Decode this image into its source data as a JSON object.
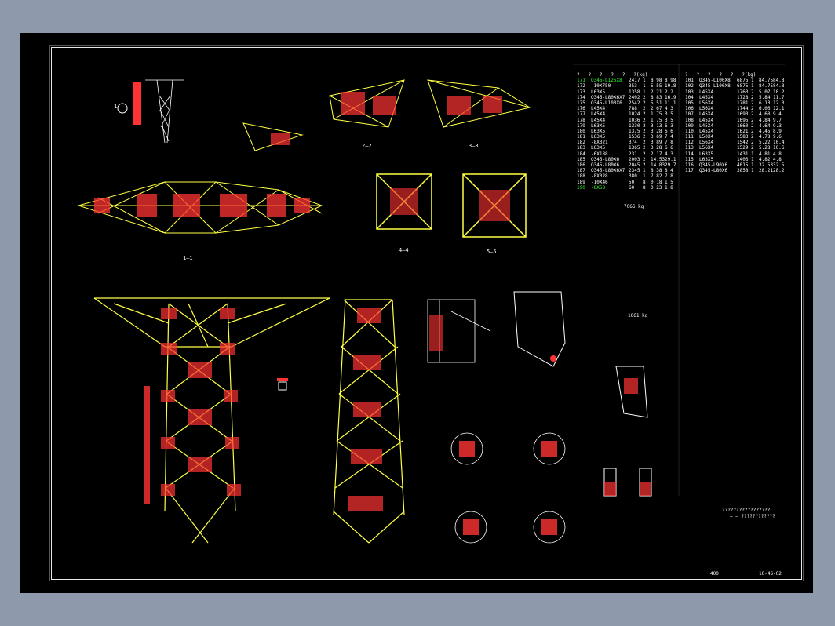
{
  "drawing": {
    "index_mark": "1",
    "section_labels": [
      "2—2",
      "3—3",
      "1—1",
      "4—4",
      "5—5"
    ],
    "total_weight_label": "7066 kg",
    "grand_total_label": "1061 kg",
    "title_block": {
      "code": "10-4S-02",
      "red_text": "400"
    }
  },
  "parts_table_left": {
    "header": [
      "?",
      "?",
      "?",
      "?",
      "?",
      "?(kg)"
    ],
    "rows": [
      {
        "no": "171",
        "spec": "Q345-L125X8",
        "len": "2417",
        "qty": "1",
        "w1": "8.98",
        "w2": "8.98",
        "hl": true
      },
      {
        "no": "172",
        "spec": "-10X750",
        "len": "353",
        "qty": "1",
        "w1": "5.55",
        "w2": "19.8",
        "hl": false
      },
      {
        "no": "173",
        "spec": "L63X5",
        "len": "1358",
        "qty": "1",
        "w1": "2.21",
        "w2": "2.2",
        "hl": false
      },
      {
        "no": "174",
        "spec": "Q345-L80X6X7",
        "len": "2402",
        "qty": "2",
        "w1": "8.83",
        "w2": "16.9",
        "hl": false
      },
      {
        "no": "175",
        "spec": "Q345-L100X6",
        "len": "2542",
        "qty": "2",
        "w1": "5.51",
        "w2": "11.1",
        "hl": false
      },
      {
        "no": "176",
        "spec": "L45X4",
        "len": "788",
        "qty": "2",
        "w1": "2.67",
        "w2": "4.3",
        "hl": false
      },
      {
        "no": "177",
        "spec": "L45X4",
        "len": "1024",
        "qty": "2",
        "w1": "1.75",
        "w2": "3.5",
        "hl": false
      },
      {
        "no": "178",
        "spec": "L45X4",
        "len": "1036",
        "qty": "2",
        "w1": "1.75",
        "w2": "3.5",
        "hl": false
      },
      {
        "no": "179",
        "spec": "L63X5",
        "len": "1330",
        "qty": "2",
        "w1": "3.13",
        "w2": "6.3",
        "hl": false
      },
      {
        "no": "180",
        "spec": "L63X5",
        "len": "1375",
        "qty": "2",
        "w1": "3.28",
        "w2": "6.6",
        "hl": false
      },
      {
        "no": "181",
        "spec": "L63X5",
        "len": "1536",
        "qty": "2",
        "w1": "3.69",
        "w2": "7.4",
        "hl": false
      },
      {
        "no": "182",
        "spec": "-8X321",
        "len": "374",
        "qty": "2",
        "w1": "3.89",
        "w2": "7.8",
        "hl": false
      },
      {
        "no": "183",
        "spec": "L63X5",
        "len": "1365",
        "qty": "2",
        "w1": "3.28",
        "w2": "6.6",
        "hl": false
      },
      {
        "no": "184",
        "spec": "-6X188",
        "len": "231",
        "qty": "2",
        "w1": "2.17",
        "w2": "4.3",
        "hl": false
      },
      {
        "no": "185",
        "spec": "Q345-L80X6",
        "len": "2003",
        "qty": "2",
        "w1": "14.53",
        "w2": "29.1",
        "hl": false
      },
      {
        "no": "186",
        "spec": "Q345-L80X6",
        "len": "2045",
        "qty": "2",
        "w1": "14.83",
        "w2": "29.7",
        "hl": false
      },
      {
        "no": "187",
        "spec": "Q345-L80X6X7",
        "len": "2345",
        "qty": "1",
        "w1": "8.38",
        "w2": "8.4",
        "hl": false
      },
      {
        "no": "188",
        "spec": "-8X328",
        "len": "380",
        "qty": "1",
        "w1": "7.82",
        "w2": "7.8",
        "hl": false
      },
      {
        "no": "189",
        "spec": "-10X46",
        "len": "50",
        "qty": "8",
        "w1": "0.18",
        "w2": "1.5",
        "hl": false
      },
      {
        "no": "190",
        "spec": "-8X58",
        "len": "60",
        "qty": "8",
        "w1": "0.23",
        "w2": "1.8",
        "hl": true
      }
    ]
  },
  "parts_table_right": {
    "header": [
      "?",
      "?",
      "?",
      "?",
      "?",
      "?(kg)"
    ],
    "rows": [
      {
        "no": "101",
        "spec": "Q345-L100X8",
        "len": "6875",
        "qty": "1",
        "w1": "84.75",
        "w2": "84.8"
      },
      {
        "no": "102",
        "spec": "Q345-L100X8",
        "len": "6875",
        "qty": "1",
        "w1": "84.75",
        "w2": "84.8"
      },
      {
        "no": "103",
        "spec": "L45X4",
        "len": "1763",
        "qty": "2",
        "w1": "5.07",
        "w2": "10.2"
      },
      {
        "no": "104",
        "spec": "L45X4",
        "len": "1728",
        "qty": "2",
        "w1": "5.84",
        "w2": "11.7"
      },
      {
        "no": "105",
        "spec": "L56X4",
        "len": "1781",
        "qty": "2",
        "w1": "6.13",
        "w2": "12.3"
      },
      {
        "no": "106",
        "spec": "L56X4",
        "len": "1744",
        "qty": "2",
        "w1": "6.06",
        "w2": "12.1"
      },
      {
        "no": "107",
        "spec": "L45X4",
        "len": "1693",
        "qty": "2",
        "w1": "4.68",
        "w2": "9.4"
      },
      {
        "no": "108",
        "spec": "L45X4",
        "len": "1695",
        "qty": "2",
        "w1": "4.84",
        "w2": "9.7"
      },
      {
        "no": "109",
        "spec": "L45X4",
        "len": "1660",
        "qty": "2",
        "w1": "4.64",
        "w2": "9.3"
      },
      {
        "no": "110",
        "spec": "L45X4",
        "len": "1621",
        "qty": "2",
        "w1": "4.45",
        "w2": "8.9"
      },
      {
        "no": "111",
        "spec": "L50X4",
        "len": "1583",
        "qty": "2",
        "w1": "4.78",
        "w2": "9.6"
      },
      {
        "no": "112",
        "spec": "L56X4",
        "len": "1542",
        "qty": "2",
        "w1": "5.22",
        "w2": "10.4"
      },
      {
        "no": "113",
        "spec": "L56X4",
        "len": "1529",
        "qty": "2",
        "w1": "5.28",
        "w2": "10.6"
      },
      {
        "no": "114",
        "spec": "L63X5",
        "len": "1431",
        "qty": "1",
        "w1": "4.81",
        "w2": "4.8"
      },
      {
        "no": "115",
        "spec": "L63X5",
        "len": "1403",
        "qty": "1",
        "w1": "4.82",
        "w2": "4.8"
      },
      {
        "no": "116",
        "spec": "Q345-L90X6",
        "len": "4015",
        "qty": "1",
        "w1": "32.53",
        "w2": "32.5"
      },
      {
        "no": "117",
        "spec": "Q345-L80X6",
        "len": "3858",
        "qty": "1",
        "w1": "28.21",
        "w2": "28.2"
      }
    ]
  },
  "notes": {
    "line1": "?????????????????",
    "line2": "— — ????????????"
  }
}
